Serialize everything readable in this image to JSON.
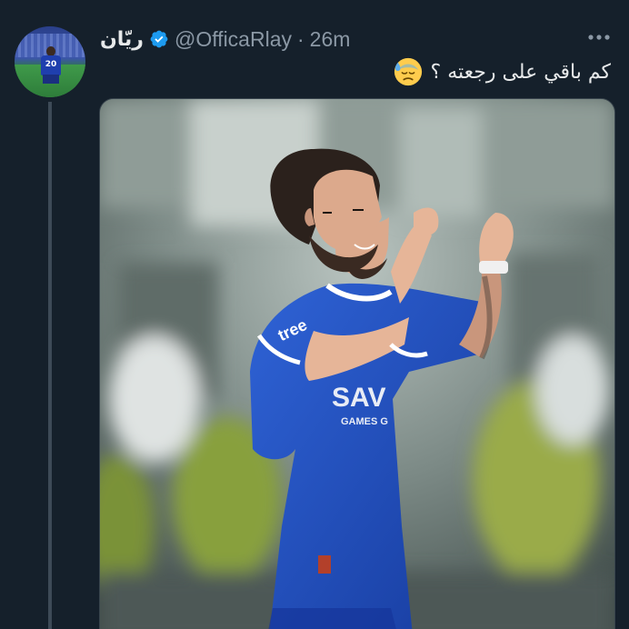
{
  "tweet": {
    "author": {
      "display_name": "ريّان",
      "handle": "@OfficaRlay",
      "separator": "·",
      "time": "26m",
      "verified": true,
      "avatar_jersey_number": "20"
    },
    "text": "كم باقي على رجعته ؟",
    "emoji": "downcast-face-with-sweat-icon",
    "media": {
      "jersey_texts": [
        "SAV",
        "GAMES G",
        "tree"
      ]
    }
  },
  "icons": {
    "more": "more-horizontal-icon",
    "verified": "verified-badge-icon"
  },
  "colors": {
    "background": "#15202b",
    "primary_text": "#e7e9ea",
    "secondary_text": "#8b98a5",
    "verified_blue": "#1d9bf0",
    "jersey_blue": "#1f4fc4"
  }
}
